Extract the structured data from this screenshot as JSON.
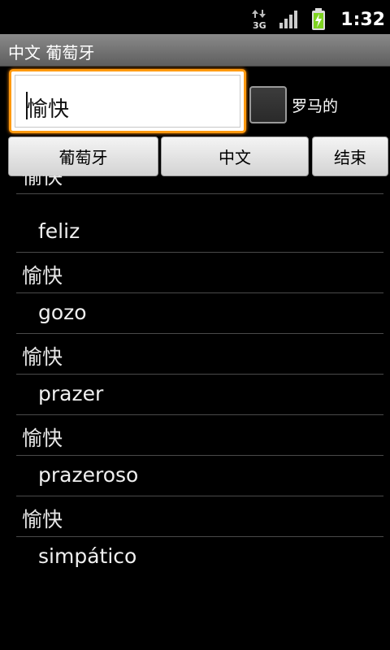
{
  "status_bar": {
    "network_label": "3G",
    "time": "1:32",
    "icons": [
      "data-activity-icon",
      "signal-strength-icon",
      "battery-charging-icon"
    ]
  },
  "title_bar": {
    "title": "中文 葡萄牙"
  },
  "search": {
    "value": "愉快"
  },
  "romanized_checkbox": {
    "label": "罗马的",
    "checked": false
  },
  "buttons": {
    "portuguese": "葡萄牙",
    "chinese": "中文",
    "end": "结束"
  },
  "results": [
    {
      "type": "head",
      "text": "愉快"
    },
    {
      "type": "sub",
      "text": "feliz"
    },
    {
      "type": "head",
      "text": "愉快"
    },
    {
      "type": "sub",
      "text": "gozo"
    },
    {
      "type": "head",
      "text": "愉快"
    },
    {
      "type": "sub",
      "text": "prazer"
    },
    {
      "type": "head",
      "text": "愉快"
    },
    {
      "type": "sub",
      "text": "prazeroso"
    },
    {
      "type": "head",
      "text": "愉快"
    },
    {
      "type": "sub",
      "text": "simpático"
    }
  ],
  "colors": {
    "focus_border": "#ff9a10",
    "background": "#000000",
    "battery_fill": "#7ed321"
  }
}
